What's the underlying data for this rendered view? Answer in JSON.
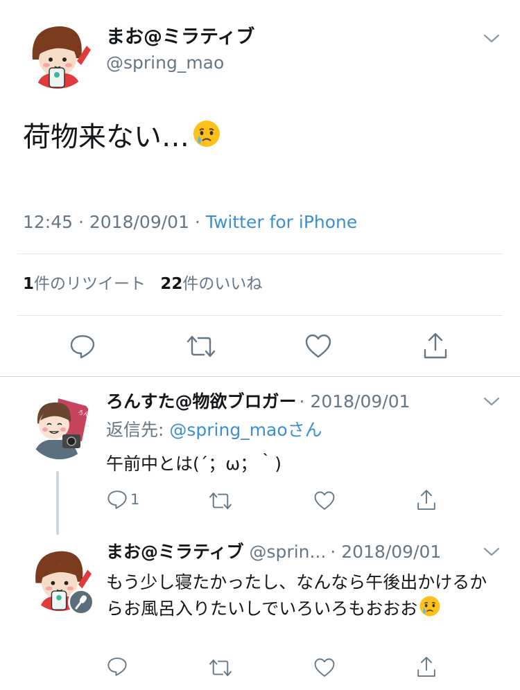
{
  "main_tweet": {
    "display_name": "まお@ミラティブ",
    "handle": "@spring_mao",
    "text": "荷物来ない…",
    "time": "12:45 · 2018/09/01 · ",
    "source": "Twitter for iPhone",
    "stats": {
      "retweet_count": "1",
      "retweet_label": "件のリツイート",
      "like_count": "22",
      "like_label": "件のいいね"
    },
    "actions": [
      "reply-icon",
      "retweet-icon",
      "like-icon",
      "share-icon"
    ]
  },
  "reply_1": {
    "display_name": "ろんすた@物欲ブロガー",
    "date": "· 2018/09/01",
    "reply_to_label": "返信先: ",
    "reply_to_handle": "@spring_maoさん",
    "text": "午前中とは(´；ω；｀)",
    "reply_count": "1"
  },
  "reply_2": {
    "display_name": "まお@ミラティブ",
    "handle": "@sprin...",
    "date": "· 2018/09/01",
    "text": "もう少し寝たかったし、なんなら午後出かけるからお風呂入りたいしでいろいろもおおお"
  },
  "colors": {
    "accent": "#3b8fd4",
    "text": "#14171a",
    "secondary": "#657786",
    "divider": "#e1e8ed"
  }
}
